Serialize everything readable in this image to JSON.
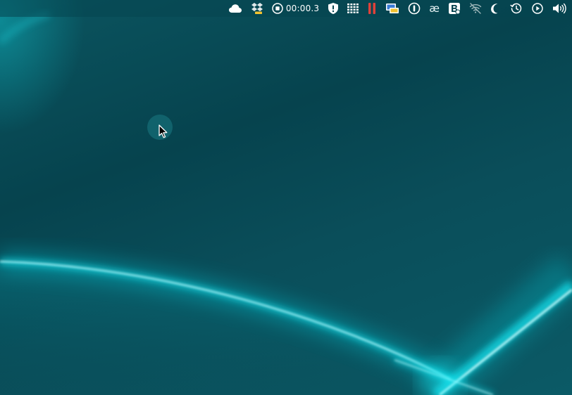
{
  "desktop": {
    "name": "desktop"
  },
  "menubar": {
    "items": [
      {
        "id": "icloud",
        "icon": "cloud-icon"
      },
      {
        "id": "dropbox-like",
        "icon": "dropbox-icon"
      },
      {
        "id": "screen-recorder",
        "icon": "stop-record-icon",
        "label": "00:00.3"
      },
      {
        "id": "security",
        "icon": "shield-alert-icon"
      },
      {
        "id": "grid-app",
        "icon": "grid-icon"
      },
      {
        "id": "pause-app",
        "icon": "pause-icon"
      },
      {
        "id": "display-app",
        "icon": "display-icon"
      },
      {
        "id": "1password",
        "icon": "password-key-icon"
      },
      {
        "id": "ae-app",
        "icon": "ae-ligature-icon",
        "glyph": "æ"
      },
      {
        "id": "b-app",
        "icon": "b-badge-icon"
      },
      {
        "id": "wifi-off",
        "icon": "wifi-off-icon"
      },
      {
        "id": "do-not-disturb",
        "icon": "moon-icon"
      },
      {
        "id": "time-machine",
        "icon": "history-icon"
      },
      {
        "id": "play-app",
        "icon": "play-circle-icon"
      },
      {
        "id": "volume",
        "icon": "volume-icon"
      }
    ],
    "timer_label": "00:00.3",
    "ae_glyph": "æ"
  },
  "colors": {
    "background": "#06434e",
    "glow": "#00e5f0",
    "menubar_text": "#ffffff",
    "pause_red": "#e0413a",
    "badge_yellow": "#f2c230"
  }
}
